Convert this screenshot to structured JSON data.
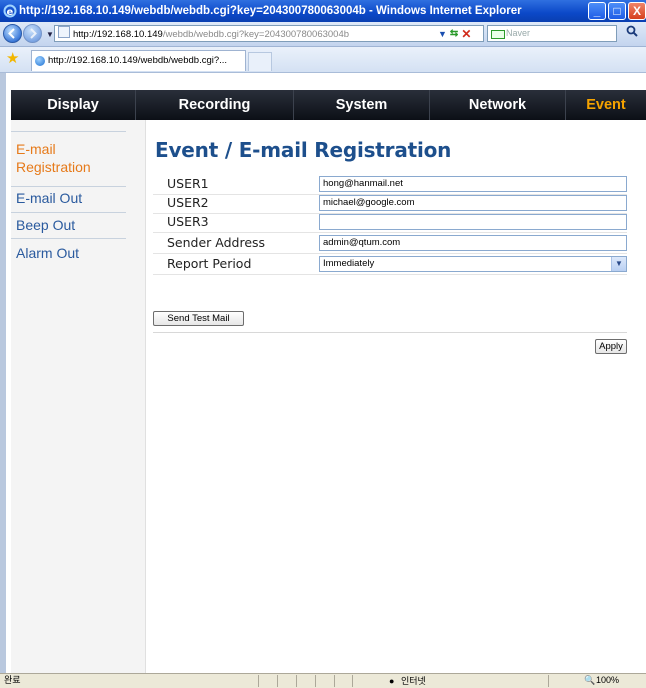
{
  "window": {
    "title": "http://192.168.10.149/webdb/webdb.cgi?key=204300780063004b - Windows Internet Explorer",
    "buttons": [
      "_",
      "□",
      "X"
    ]
  },
  "address_bar": {
    "url_host": "http://192.168.10.149",
    "url_rest": "/webdb/webdb.cgi?key=204300780063004b",
    "search_placeholder": "Naver",
    "search_icon": "magnifier-icon"
  },
  "tab": {
    "label": "http://192.168.10.149/webdb/webdb.cgi?..."
  },
  "menu": [
    {
      "label": "Display",
      "active": false
    },
    {
      "label": "Recording",
      "active": false
    },
    {
      "label": "System",
      "active": false
    },
    {
      "label": "Network",
      "active": false
    },
    {
      "label": "Event",
      "active": true
    }
  ],
  "sidebar": [
    {
      "label": "E-mail Registration",
      "active": true
    },
    {
      "label": "E-mail Out",
      "active": false
    },
    {
      "label": "Beep Out",
      "active": false
    },
    {
      "label": "Alarm Out",
      "active": false
    }
  ],
  "page_title": "Event / E-mail Registration",
  "form": {
    "user1": {
      "label": "USER1",
      "value": "hong@hanmail.net"
    },
    "user2": {
      "label": "USER2",
      "value": "michael@google.com"
    },
    "user3": {
      "label": "USER3",
      "value": ""
    },
    "sender": {
      "label": "Sender Address",
      "value": "admin@qtum.com"
    },
    "report": {
      "label": "Report Period",
      "value": "Immediately"
    }
  },
  "buttons": {
    "send_test": "Send Test Mail",
    "apply": "Apply"
  },
  "status_bar": {
    "left": "완료",
    "zone": "인터넷",
    "zoom": "100%"
  },
  "colors": {
    "menu_active": "#f5a300",
    "sidebar_active": "#e67a1a",
    "sidebar_link": "#2a5a9e",
    "heading": "#1d4f8c"
  }
}
